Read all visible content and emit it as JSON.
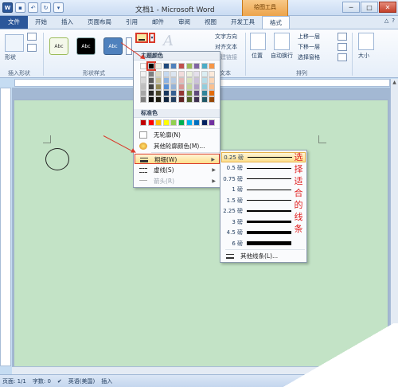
{
  "window": {
    "title": "文档1 - Microsoft Word",
    "context_tab_title": "绘图工具",
    "controls": [
      "─",
      "□",
      "✕"
    ]
  },
  "tabs": [
    {
      "label": "文件"
    },
    {
      "label": "开始"
    },
    {
      "label": "插入"
    },
    {
      "label": "页面布局"
    },
    {
      "label": "引用"
    },
    {
      "label": "邮件"
    },
    {
      "label": "审阅"
    },
    {
      "label": "视图"
    },
    {
      "label": "开发工具"
    },
    {
      "label": "格式"
    }
  ],
  "ribbon": {
    "shape_label": "形状",
    "insert_shapes_label": "插入形状",
    "shape_styles_label": "形状样式",
    "style_boxes": [
      "Abc",
      "Abc",
      "Abc"
    ],
    "wordart_text": "A",
    "text_direction": "文字方向",
    "align_text": "对齐文本",
    "create_link": "创建链接",
    "text_group": "文本",
    "position": "位置",
    "wrap_text": "自动换行",
    "bring_forward": "上移一层",
    "send_backward": "下移一层",
    "selection_pane": "选择窗格",
    "arrange_group": "排列",
    "size": "大小"
  },
  "menu": {
    "theme_colors_label": "主题颜色",
    "standard_colors_label": "标准色",
    "theme_colors": [
      [
        "#ffffff",
        "#000000",
        "#eeece1",
        "#1f497d",
        "#4f81bd",
        "#c0504d",
        "#9bbb59",
        "#8064a2",
        "#4bacc6",
        "#f79646"
      ],
      [
        "#f2f2f2",
        "#7f7f7f",
        "#ddd9c3",
        "#c6d9f0",
        "#dbe5f1",
        "#f2dcdb",
        "#ebf1dd",
        "#e5e0ec",
        "#dbeef3",
        "#fdeada"
      ],
      [
        "#d8d8d8",
        "#595959",
        "#c4bd97",
        "#8db3e2",
        "#b8cce4",
        "#e5b9b7",
        "#d7e3bc",
        "#ccc1d9",
        "#b7dde8",
        "#fbd5b5"
      ],
      [
        "#bfbfbf",
        "#3f3f3f",
        "#938953",
        "#548dd4",
        "#95b3d7",
        "#d99694",
        "#c3d69b",
        "#b2a2c7",
        "#92cddc",
        "#fac08f"
      ],
      [
        "#a5a5a5",
        "#262626",
        "#494429",
        "#17365d",
        "#366092",
        "#953734",
        "#76923c",
        "#5f497a",
        "#31859b",
        "#e36c09"
      ],
      [
        "#7f7f7f",
        "#0c0c0c",
        "#1d1b10",
        "#0f243e",
        "#244061",
        "#632423",
        "#4f6128",
        "#3f3151",
        "#205867",
        "#974806"
      ]
    ],
    "standard_colors": [
      "#c00000",
      "#ff0000",
      "#ffc000",
      "#ffff00",
      "#92d050",
      "#00b050",
      "#00b0f0",
      "#0070c0",
      "#002060",
      "#7030a0"
    ],
    "items": [
      {
        "label": "无轮廓(N)"
      },
      {
        "label": "其他轮廓颜色(M)..."
      },
      {
        "label": "粗细(W)"
      },
      {
        "label": "虚线(S)"
      },
      {
        "label": "箭头(R)"
      }
    ]
  },
  "weight_menu": {
    "items": [
      {
        "label": "0.25 磅",
        "weight": 0.25
      },
      {
        "label": "0.5 磅",
        "weight": 0.5
      },
      {
        "label": "0.75 磅",
        "weight": 0.75
      },
      {
        "label": "1 磅",
        "weight": 1
      },
      {
        "label": "1.5 磅",
        "weight": 1.5
      },
      {
        "label": "2.25 磅",
        "weight": 2.25
      },
      {
        "label": "3 磅",
        "weight": 3
      },
      {
        "label": "4.5 磅",
        "weight": 4.5
      },
      {
        "label": "6 磅",
        "weight": 6
      }
    ],
    "selected_index": 0,
    "more_lines": "其他线条(L)..."
  },
  "annotation": {
    "text": "选择适合的线条"
  },
  "status": {
    "page": "页面: 1/1",
    "words": "字数: 0",
    "language": "英语(美国)",
    "mode": "插入"
  },
  "colors": {
    "accent_red": "#d93a2b",
    "page_bg": "#c3e3c6",
    "file_tab": "#2b579a"
  }
}
